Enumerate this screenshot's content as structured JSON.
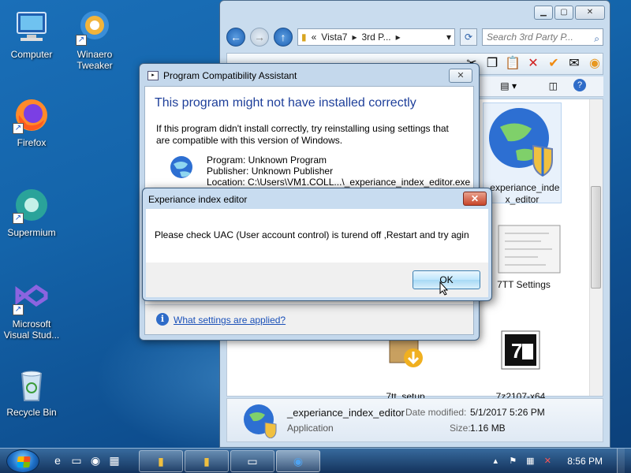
{
  "desktop": {
    "icons": [
      {
        "label": "Computer"
      },
      {
        "label": "Winaero Tweaker"
      },
      {
        "label": "Firefox"
      },
      {
        "label": "Supermium"
      },
      {
        "label": "Microsoft Visual Stud..."
      },
      {
        "label": "Recycle Bin"
      }
    ]
  },
  "explorer": {
    "address": {
      "seg1": "Vista7",
      "seg2": "3rd P...",
      "prefix": "«"
    },
    "search_placeholder": "Search 3rd Party P...",
    "files": [
      {
        "name": "_experiance_inde x_editor"
      },
      {
        "name": "7TT Settings"
      },
      {
        "name": "7tt_setup"
      },
      {
        "name": "7z2107-x64"
      }
    ],
    "details": {
      "name": "_experiance_index_editor",
      "type": "Application",
      "modified_label": "Date modified:",
      "modified_value": "5/1/2017 5:26 PM",
      "size_label": "Size:",
      "size_value": "1.16 MB"
    }
  },
  "pca": {
    "title": "Program Compatibility Assistant",
    "heading": "This program might not have installed correctly",
    "text": "If this program didn't install correctly, try reinstalling using settings that are compatible with this version of Windows.",
    "program": "Program: Unknown Program",
    "publisher": "Publisher: Unknown Publisher",
    "location": "Location: C:\\Users\\VM1.COLL...\\_experiance_index_editor.exe",
    "link": "What settings are applied?"
  },
  "dialog": {
    "title": "Experiance index editor",
    "message": "Please check UAC (User account control) is turend off ,Restart and try agin",
    "ok": "OK"
  },
  "taskbar": {
    "clock": "8:56 PM"
  }
}
